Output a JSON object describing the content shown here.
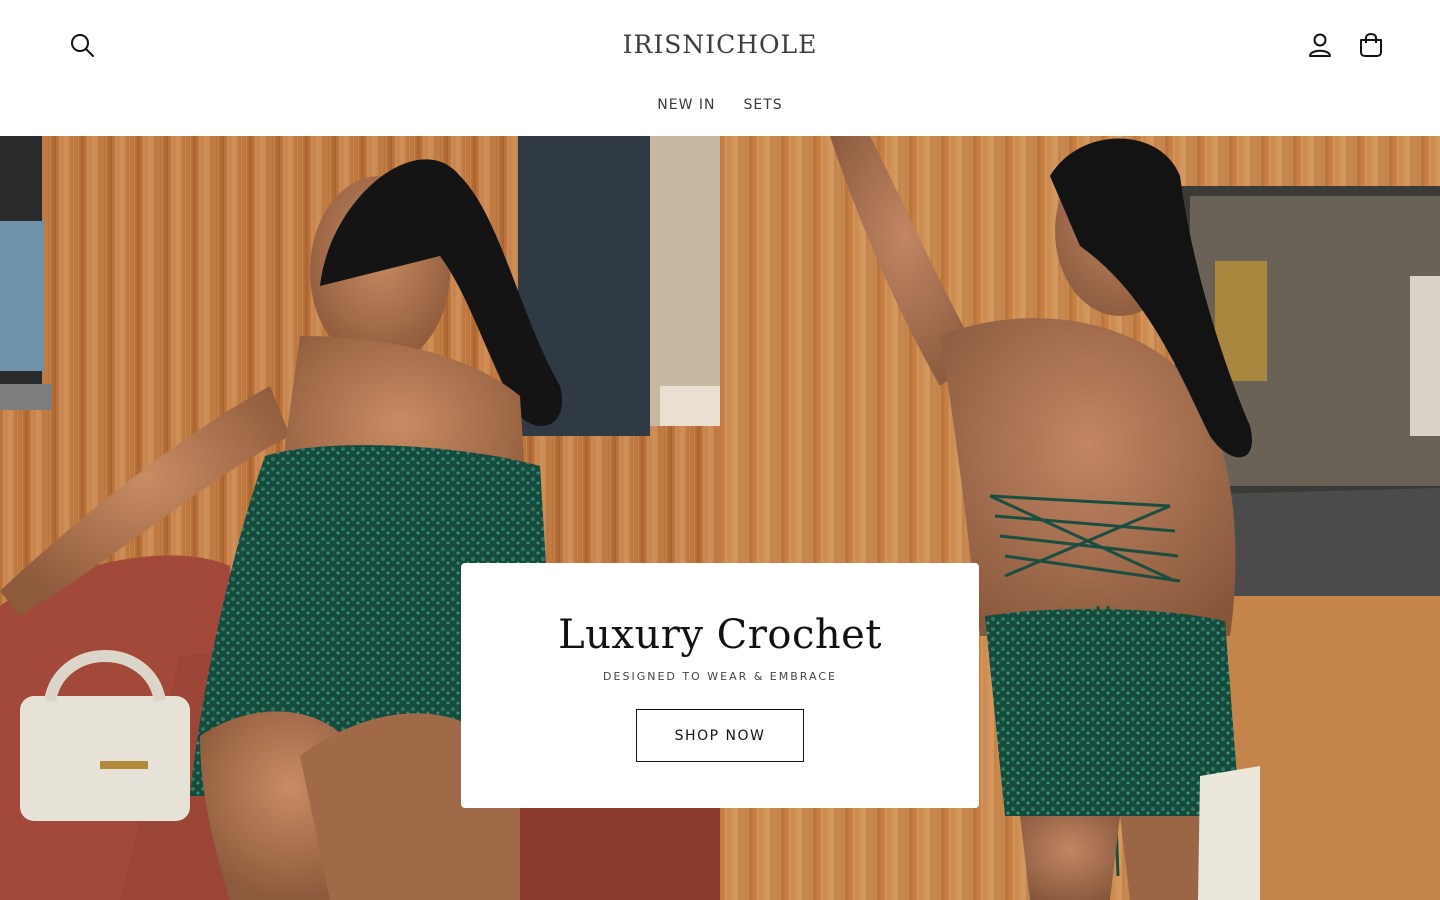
{
  "header": {
    "logo": "IRISNICHOLE",
    "nav": [
      {
        "label": "NEW IN"
      },
      {
        "label": "SETS"
      }
    ],
    "icons": {
      "search": "search-icon",
      "account": "account-icon",
      "cart": "cart-icon"
    }
  },
  "hero": {
    "title": "Luxury Crochet",
    "subtitle": "DESIGNED TO WEAR & EMBRACE",
    "button_label": "SHOP NOW"
  },
  "colors": {
    "text": "#121212",
    "background": "#ffffff",
    "wood": "#c9874a",
    "dress": "#1f5a4a"
  }
}
